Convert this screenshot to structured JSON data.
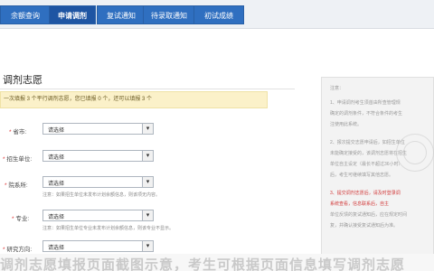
{
  "tabs": [
    {
      "label": "余额查询"
    },
    {
      "label": "申请调剂"
    },
    {
      "label": "复试通知"
    },
    {
      "label": "待录取通知"
    },
    {
      "label": "初试成绩"
    }
  ],
  "page_title": "调剂志愿",
  "notice_text": "一次填报 3 个平行调剂志愿，您已填报 0 个，还可以填报 3 个",
  "form": {
    "province_label": "省市:",
    "unit_label": "招生单位:",
    "dept_label": "院系所:",
    "major_label": "专业:",
    "direction_label": "研究方向:",
    "select_value": "请选择",
    "dept_hint": "注意：如果招生单位未发布计划余额信息，则该项无内容。",
    "major_hint": "注意：如果招生单位专业未发布计划余额信息，则该专业不显示。"
  },
  "side_notes": [
    "注意：",
    "1、申请调剂考生须首由所查管理规",
    "   确定的调剂条件，不符合条件的考生",
    "   注使用此系统。",
    "2、报次提交志愿申请后，如招生单位",
    "   未能确定接受的，该调剂志愿将在招生",
    "   单位自主设定（最长不超过36小时）",
    "   后，考生可继续填写其他志愿。",
    "3、提交调剂志愿后，请及时登录调",
    "   系统查看，信息联系后，自主",
    "   单位反馈的复试通知后，应在规定时间",
    "   复，并确认接受复试通知后为准。"
  ],
  "caption_text": "调剂志愿填报页面截图示意，考生可根据页面信息填写调剂志愿"
}
